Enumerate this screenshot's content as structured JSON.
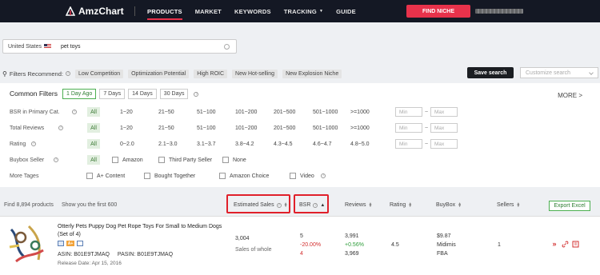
{
  "app": {
    "brand": "AmzChart",
    "accent": "#e8324b"
  },
  "nav": {
    "items": [
      {
        "label": "PRODUCTS"
      },
      {
        "label": "MARKET"
      },
      {
        "label": "KEYWORDS"
      },
      {
        "label": "TRACKING"
      },
      {
        "label": "GUIDE"
      }
    ],
    "find_niche": "FIND NICHE"
  },
  "search": {
    "marketplace": "United States",
    "keyword": "pet toys"
  },
  "filters_recommend": {
    "label": "Filters Recommend:",
    "chips": [
      "Low Competition",
      "Optimization Potential",
      "High ROIC",
      "New Hot-selling",
      "New Explosion Niche"
    ],
    "save_search": "Save search",
    "custom_search_placeholder": "Customize search"
  },
  "common_filters": {
    "title": "Common Filters",
    "tabs": [
      "1 Day Ago",
      "7 Days",
      "14 Days",
      "30 Days"
    ],
    "active_tab": "1 Day Ago",
    "more": "MORE >",
    "rows": [
      {
        "label": "BSR in Primary Cat.",
        "all": "All",
        "options": [
          "1~20",
          "21~50",
          "51~100",
          "101~200",
          "201~500",
          "501~1000",
          ">=1000"
        ],
        "min": "Min",
        "max": "Max"
      },
      {
        "label": "Total Reviews",
        "all": "All",
        "options": [
          "1~20",
          "21~50",
          "51~100",
          "101~200",
          "201~500",
          "501~1000",
          ">=1000"
        ],
        "min": "Min",
        "max": "Max"
      },
      {
        "label": "Rating",
        "all": "All",
        "options": [
          "0~2.0",
          "2.1~3.0",
          "3.1~3.7",
          "3.8~4.2",
          "4.3~4.5",
          "4.6~4.7",
          "4.8~5.0"
        ],
        "min": "Min",
        "max": "Max"
      },
      {
        "label": "Buybox Seller",
        "all": "All",
        "checkboxes": [
          "Amazon",
          "Third Party Seller",
          "None"
        ]
      },
      {
        "label": "More Tages",
        "checkboxes": [
          "A+ Content",
          "Bought Together",
          "Amazon Choice",
          "Video"
        ]
      }
    ]
  },
  "results": {
    "found": "Find 8,894 products",
    "shown": "Show you the first 600",
    "columns": [
      "Estimated Sales",
      "BSR",
      "Reviews",
      "Rating",
      "BuyBox",
      "Sellers"
    ],
    "export": "Export Excel",
    "products": [
      {
        "title": "Otterly Pets Puppy Dog Pet Rope Toys For Small to Medium Dogs (Set of 4)",
        "asin": "ASIN: B01E9TJMAQ",
        "pasin": "PASIN: B01E9TJMAQ",
        "release": "Release Date: Apr 15, 2016",
        "est_sales": "3,004",
        "sales_note": "Sales of whole",
        "bsr": "5",
        "bsr_change": "-20.00%",
        "bsr_sub": "4",
        "reviews": "3,991",
        "reviews_change": "+0.56%",
        "reviews_prev": "3,969",
        "rating": "4.5",
        "buybox_price": "$9.87",
        "buybox_seller": "Midimis",
        "buybox_type": "FBA",
        "sellers": "1",
        "badge_a": "A+"
      }
    ]
  }
}
